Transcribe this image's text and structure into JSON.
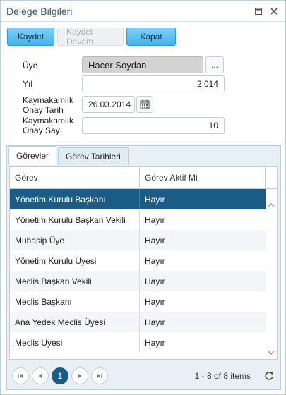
{
  "window": {
    "title": "Delege Bilgileri"
  },
  "toolbar": {
    "save_label": "Kaydet",
    "save_continue_label": "Kaydet Devam",
    "close_label": "Kapat"
  },
  "form": {
    "member_label": "Üye",
    "member_value": "Hacer Soydan",
    "member_lookup_label": "...",
    "year_label": "Yıl",
    "year_value": "2.014",
    "approval_date_label_1": "Kaymakamlık",
    "approval_date_label_2": "Onay Tarih",
    "approval_date_value": "26.03.2014",
    "approval_no_label_1": "Kaymakamlık",
    "approval_no_label_2": "Onay Sayı",
    "approval_no_value": "10"
  },
  "tabs": [
    {
      "label": "Görevler",
      "active": true
    },
    {
      "label": "Görev Tarihleri",
      "active": false
    }
  ],
  "grid": {
    "columns": [
      "Görev",
      "Görev Aktif Mi"
    ],
    "rows": [
      {
        "gorev": "Yönetim Kurulu Başkanı",
        "aktif": "Hayır",
        "selected": true
      },
      {
        "gorev": "Yönetim Kurulu Başkan Vekili",
        "aktif": "Hayır"
      },
      {
        "gorev": "Muhasip Üye",
        "aktif": "Hayır"
      },
      {
        "gorev": "Yönetim Kurulu Üyesi",
        "aktif": "Hayır"
      },
      {
        "gorev": "Meclis Başkan Vekili",
        "aktif": "Hayır"
      },
      {
        "gorev": "Meclis Başkanı",
        "aktif": "Hayır"
      },
      {
        "gorev": "Ana Yedek Meclis Üyesi",
        "aktif": "Hayır"
      },
      {
        "gorev": "Meclis Üyesi",
        "aktif": "Hayır"
      }
    ]
  },
  "pager": {
    "current_page": "1",
    "info": "1 - 8 of 8 items"
  },
  "colors": {
    "accent": "#43b2ec",
    "selected_row": "#1b5c87",
    "border": "#b9cfe0"
  }
}
